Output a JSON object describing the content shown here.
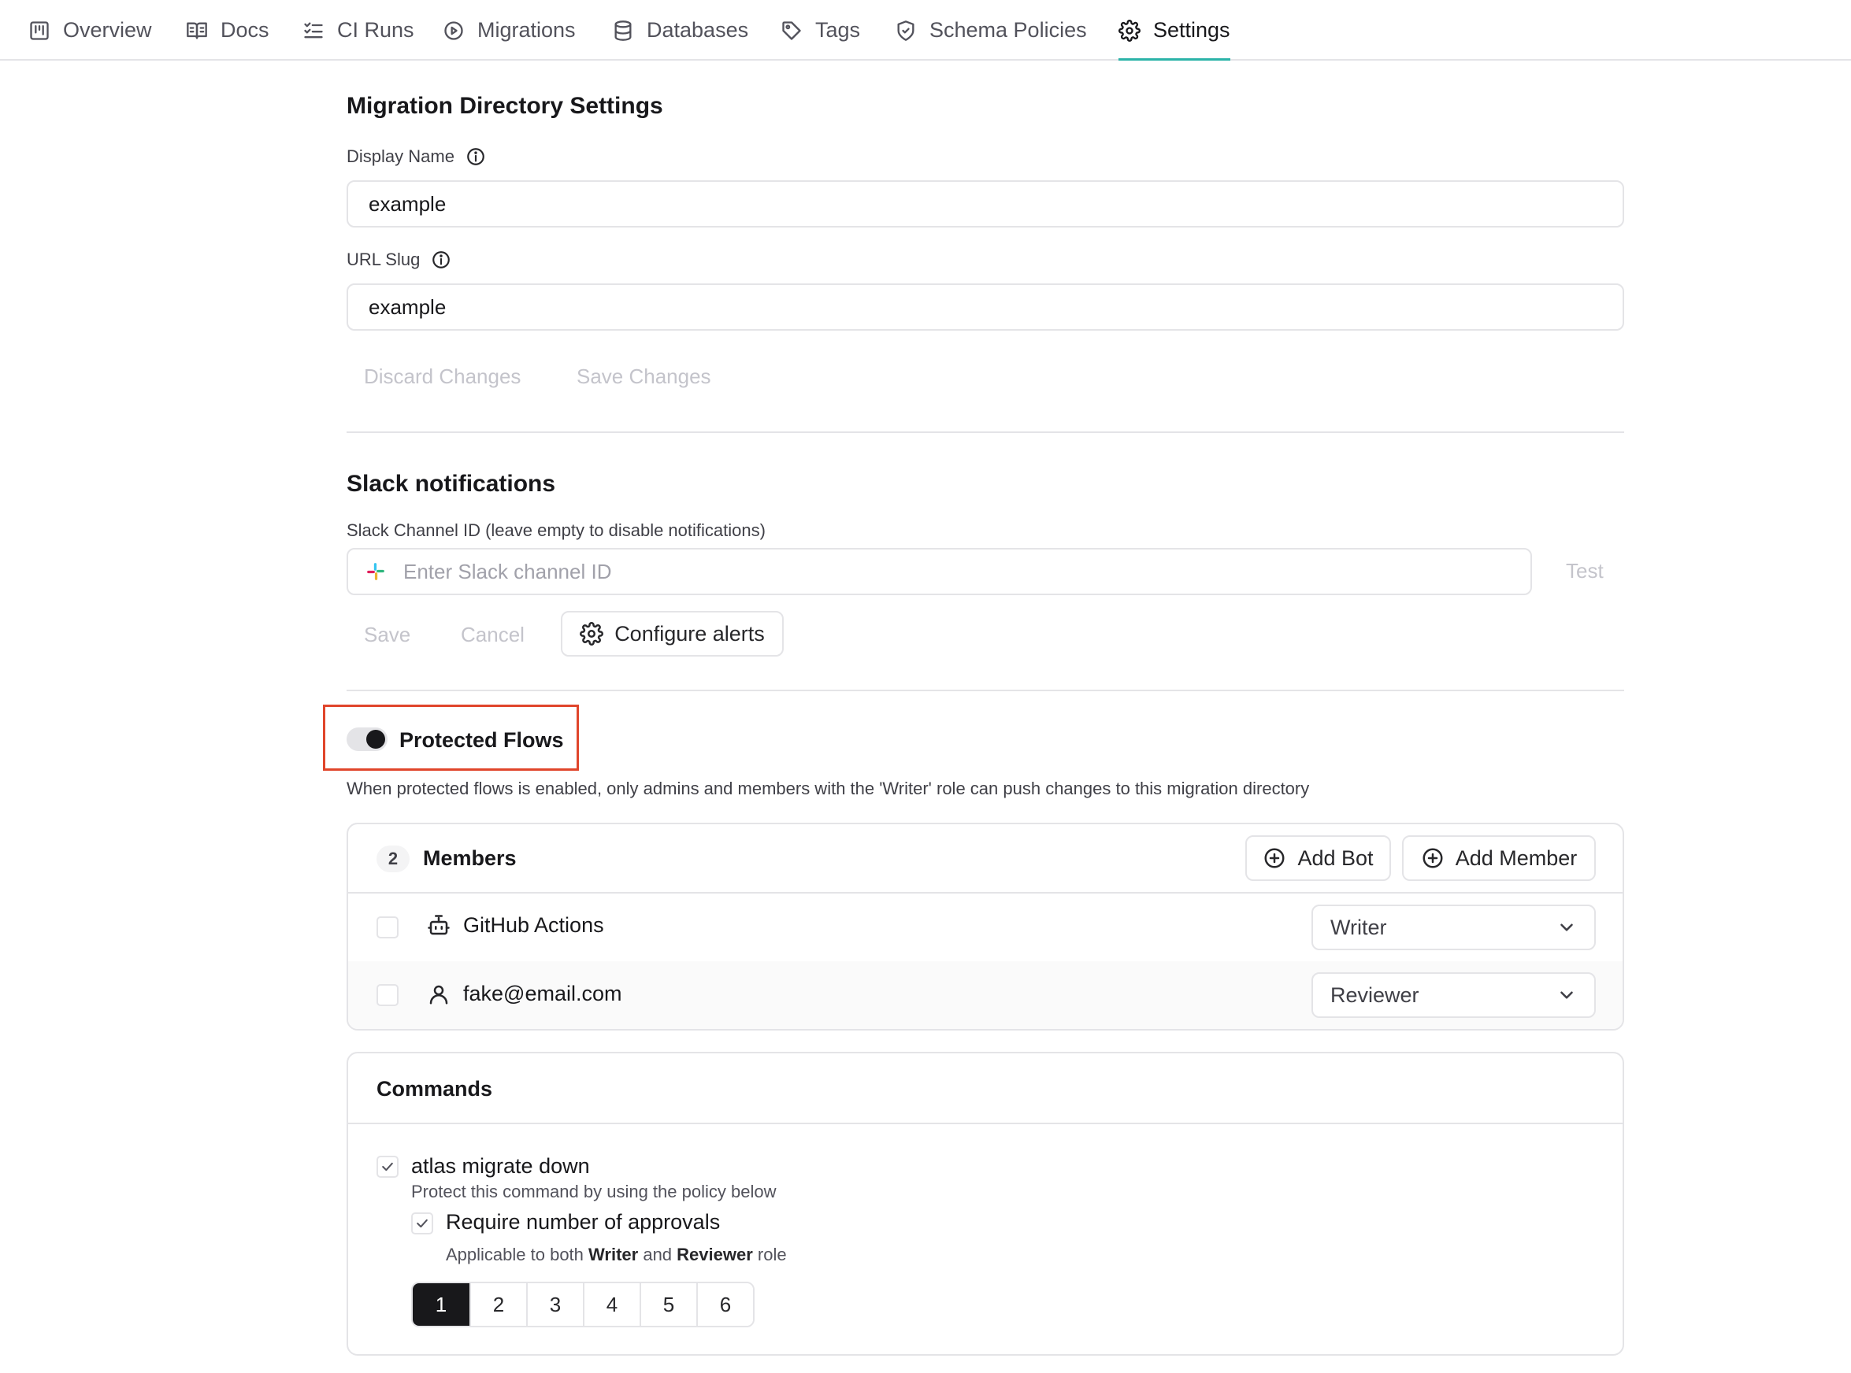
{
  "nav": {
    "tabs": [
      {
        "label": "Overview",
        "icon": "kanban-icon"
      },
      {
        "label": "Docs",
        "icon": "book-icon"
      },
      {
        "label": "CI Runs",
        "icon": "list-check-icon"
      },
      {
        "label": "Migrations",
        "icon": "play-circle-icon"
      },
      {
        "label": "Databases",
        "icon": "database-icon"
      },
      {
        "label": "Tags",
        "icon": "tag-icon"
      },
      {
        "label": "Schema Policies",
        "icon": "shield-check-icon"
      },
      {
        "label": "Settings",
        "icon": "gear-icon"
      }
    ],
    "active_tab": "Settings",
    "accent_color": "#2bb3a8"
  },
  "directory": {
    "title": "Migration Directory Settings",
    "display_name_label": "Display Name",
    "display_name_value": "example",
    "url_slug_label": "URL Slug",
    "url_slug_value": "example",
    "discard_label": "Discard Changes",
    "save_label": "Save Changes"
  },
  "slack": {
    "title": "Slack notifications",
    "channel_label": "Slack Channel ID (leave empty to disable notifications)",
    "channel_placeholder": "Enter Slack channel ID",
    "test_label": "Test",
    "save_label": "Save",
    "cancel_label": "Cancel",
    "configure_label": "Configure alerts"
  },
  "protected_flows": {
    "title": "Protected Flows",
    "enabled": true,
    "description": "When protected flows is enabled, only admins and members with the 'Writer' role can push changes to this migration directory",
    "highlight_color": "#e0452b"
  },
  "members": {
    "count": "2",
    "title": "Members",
    "add_bot_label": "Add Bot",
    "add_member_label": "Add Member",
    "rows": [
      {
        "name": "GitHub Actions",
        "type": "bot",
        "icon": "bot-icon",
        "role": "Writer"
      },
      {
        "name": "fake@email.com",
        "type": "user",
        "icon": "user-icon",
        "role": "Reviewer"
      }
    ]
  },
  "commands": {
    "title": "Commands",
    "command_name": "atlas migrate down",
    "command_checked": true,
    "command_desc": "Protect this command by using the policy below",
    "approvals_label": "Require number of approvals",
    "approvals_checked": true,
    "applicable_prefix": "Applicable to both",
    "applicable_role1": "Writer",
    "applicable_and": "and",
    "applicable_role2": "Reviewer",
    "applicable_suffix": "role",
    "approval_options": [
      "1",
      "2",
      "3",
      "4",
      "5",
      "6"
    ],
    "selected_approval": "1"
  }
}
